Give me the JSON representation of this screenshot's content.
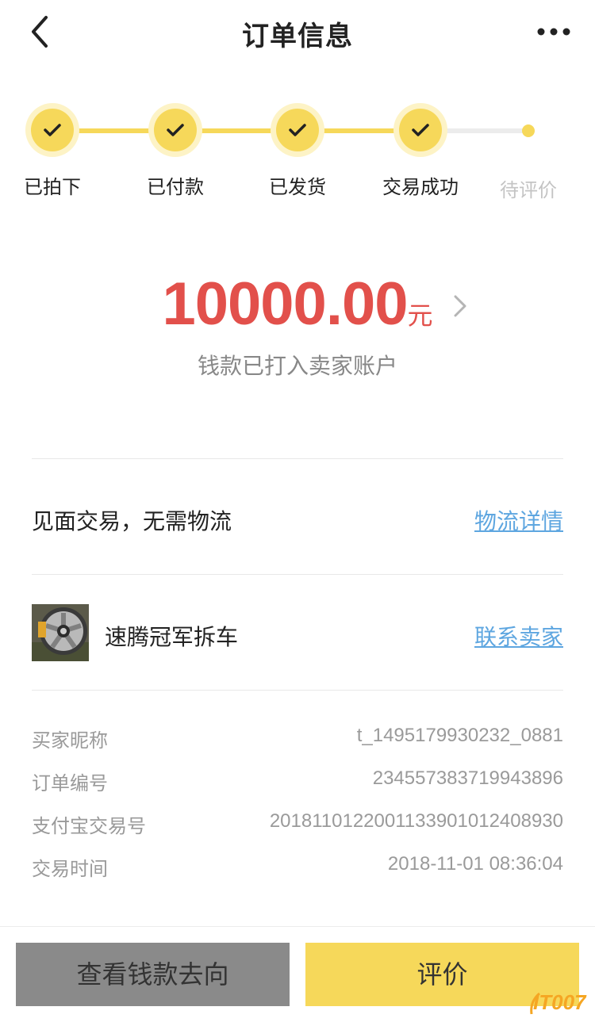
{
  "header": {
    "title": "订单信息"
  },
  "steps": [
    {
      "label": "已拍下",
      "state": "done"
    },
    {
      "label": "已付款",
      "state": "done"
    },
    {
      "label": "已发货",
      "state": "done"
    },
    {
      "label": "交易成功",
      "state": "done"
    },
    {
      "label": "待评价",
      "state": "pending"
    }
  ],
  "amount": {
    "value": "10000.00",
    "unit": "元",
    "description": "钱款已打入卖家账户"
  },
  "logistics": {
    "text": "见面交易，无需物流",
    "link_label": "物流详情"
  },
  "seller": {
    "name": "速腾冠军拆车",
    "link_label": "联系卖家"
  },
  "info": [
    {
      "key": "买家昵称",
      "value": "t_1495179930232_0881"
    },
    {
      "key": "订单编号",
      "value": "234557383719943896"
    },
    {
      "key": "支付宝交易号",
      "value": "2018110122001133901012408930"
    },
    {
      "key": "交易时间",
      "value": "2018-11-01 08:36:04"
    }
  ],
  "actions": {
    "view_money_label": "查看钱款去向",
    "review_label": "评价"
  },
  "watermark": "IT007",
  "colors": {
    "accent_yellow": "#f6d85a",
    "amount_red": "#e2504b",
    "link_blue": "#5ea6e0",
    "muted_gray": "#9a9a9a"
  }
}
